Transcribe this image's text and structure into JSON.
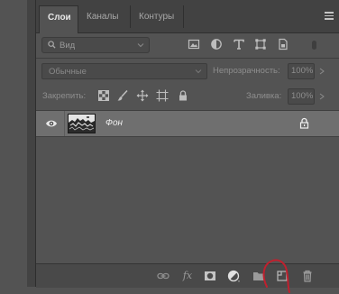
{
  "tabs": [
    {
      "label": "Слои",
      "active": true
    },
    {
      "label": "Каналы",
      "active": false
    },
    {
      "label": "Контуры",
      "active": false
    }
  ],
  "filter": {
    "kind_label": "Вид",
    "icons": [
      "image-filter-icon",
      "adjustment-filter-icon",
      "type-filter-icon",
      "shape-filter-icon",
      "smart-object-filter-icon"
    ]
  },
  "blend": {
    "mode": "Обычные",
    "opacity_label": "Непрозрачность:",
    "opacity_value": "100%"
  },
  "lock": {
    "label": "Закрепить:",
    "icons": [
      "lock-transparent-pixels-icon",
      "lock-image-pixels-icon",
      "lock-position-icon",
      "lock-artboard-icon",
      "lock-all-icon"
    ],
    "fill_label": "Заливка:",
    "fill_value": "100%"
  },
  "layers": [
    {
      "name": "Фон",
      "visible": true,
      "locked": true
    }
  ],
  "bottom_icons": [
    "link-layers-icon",
    "fx-icon",
    "add-mask-icon",
    "new-adjustment-layer-icon",
    "new-group-icon",
    "new-layer-icon",
    "delete-layer-icon"
  ],
  "colors": {
    "panel_bg": "#535353",
    "selected_layer": "#6f6f6f",
    "annotation": "#c0202e"
  }
}
